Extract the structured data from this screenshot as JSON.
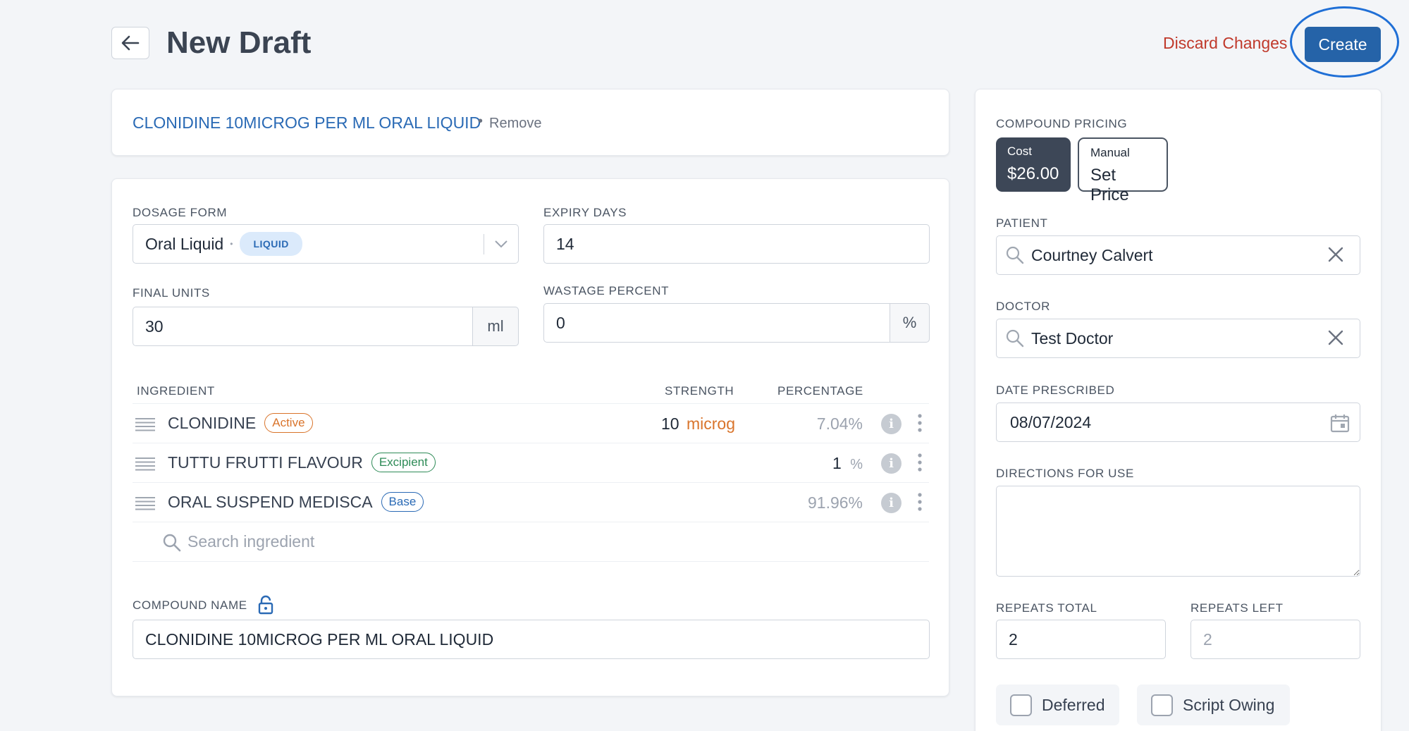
{
  "header": {
    "title": "New Draft",
    "discard_label": "Discard Changes",
    "create_label": "Create"
  },
  "compound": {
    "name_link": "CLONIDINE 10MICROG PER ML ORAL LIQUID",
    "separator": "•",
    "remove_label": "Remove"
  },
  "form": {
    "dosage_form_label": "DOSAGE FORM",
    "dosage_form_value": "Oral Liquid",
    "dosage_form_dot": "•",
    "dosage_form_badge": "LIQUID",
    "expiry_days_label": "EXPIRY DAYS",
    "expiry_days_value": "14",
    "final_units_label": "FINAL UNITS",
    "final_units_value": "30",
    "final_units_unit": "ml",
    "wastage_label": "WASTAGE PERCENT",
    "wastage_value": "0",
    "wastage_unit": "%"
  },
  "ingredients": {
    "col_ingredient": "INGREDIENT",
    "col_strength": "STRENGTH",
    "col_percentage": "PERCENTAGE",
    "rows": [
      {
        "name": "CLONIDINE",
        "type": "Active",
        "strength": "10",
        "strength_unit": "microg",
        "percentage": "7.04%"
      },
      {
        "name": "TUTTU FRUTTI FLAVOUR",
        "type": "Excipient",
        "strength": "1",
        "strength_unit": "%",
        "percentage": ""
      },
      {
        "name": "ORAL SUSPEND MEDISCA",
        "type": "Base",
        "strength": "",
        "strength_unit": "",
        "percentage": "91.96%"
      }
    ],
    "search_placeholder": "Search ingredient",
    "info_glyph": "i"
  },
  "compound_name": {
    "label": "COMPOUND NAME",
    "value": "CLONIDINE 10MICROG PER ML ORAL LIQUID"
  },
  "sidebar": {
    "pricing_label": "COMPOUND PRICING",
    "pricing_options": [
      {
        "label": "Cost",
        "value": "$26.00"
      },
      {
        "label": "Manual",
        "value": "Set Price"
      }
    ],
    "patient_label": "PATIENT",
    "patient_value": "Courtney Calvert",
    "doctor_label": "DOCTOR",
    "doctor_value": "Test Doctor",
    "date_label": "DATE PRESCRIBED",
    "date_value": "08/07/2024",
    "directions_label": "DIRECTIONS FOR USE",
    "directions_value": "",
    "repeats_total_label": "REPEATS TOTAL",
    "repeats_total_value": "2",
    "repeats_left_label": "REPEATS LEFT",
    "repeats_left_value": "2",
    "deferred_label": "Deferred",
    "script_owing_label": "Script Owing"
  },
  "colors": {
    "primary": "#2563a8",
    "danger": "#c0392b",
    "active": "#d9742b",
    "excipient": "#2e8b57",
    "base": "#2a6ab5"
  }
}
